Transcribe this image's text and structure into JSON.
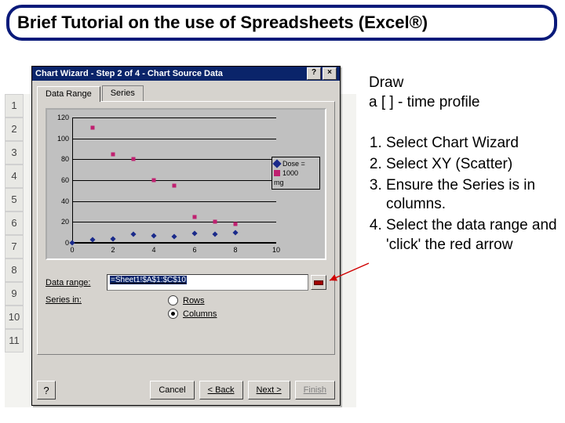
{
  "banner_title": "Brief Tutorial on the use of Spreadsheets (Excel®)",
  "right": {
    "heading": "Draw\na [ ] - time profile",
    "steps": [
      "Select Chart Wizard",
      " Select XY (Scatter)",
      "Ensure the Series is in columns.",
      "Select the data range and 'click' the red arrow"
    ]
  },
  "sheet_rows": [
    "1",
    "2",
    "3",
    "4",
    "5",
    "6",
    "7",
    "8",
    "9",
    "10",
    "11"
  ],
  "wizard": {
    "title": "Chart Wizard - Step 2 of 4 - Chart Source Data",
    "help_btn": "?",
    "close_btn": "×",
    "tabs": {
      "data_range": "Data Range",
      "series": "Series"
    },
    "data_range_label": "Data range:",
    "data_range_value": "=Sheet1!$A$1:$C$10",
    "series_in_label": "Series in:",
    "rows_label": "Rows",
    "columns_label": "Columns",
    "buttons": {
      "cancel": "Cancel",
      "back": "< Back",
      "next": "Next >",
      "finish": "Finish",
      "help": "?"
    }
  },
  "chart_data": {
    "type": "scatter",
    "x": [
      0,
      1,
      2,
      3,
      4,
      5,
      6,
      7,
      8
    ],
    "series": [
      {
        "name": "Dose =",
        "marker": "diamond",
        "color": "#1a2a8a",
        "values": [
          0,
          3,
          4,
          8,
          7,
          6,
          9,
          8,
          10
        ]
      },
      {
        "name": "1000",
        "marker": "square",
        "color": "#c02070",
        "values": [
          null,
          110,
          85,
          80,
          60,
          55,
          25,
          20,
          18
        ]
      }
    ],
    "legend_extra": "mg",
    "ylim": [
      0,
      120
    ],
    "xlim": [
      0,
      10
    ],
    "yticks": [
      0,
      20,
      40,
      60,
      80,
      100,
      120
    ],
    "xticks": [
      0,
      2,
      4,
      6,
      8,
      10
    ]
  }
}
